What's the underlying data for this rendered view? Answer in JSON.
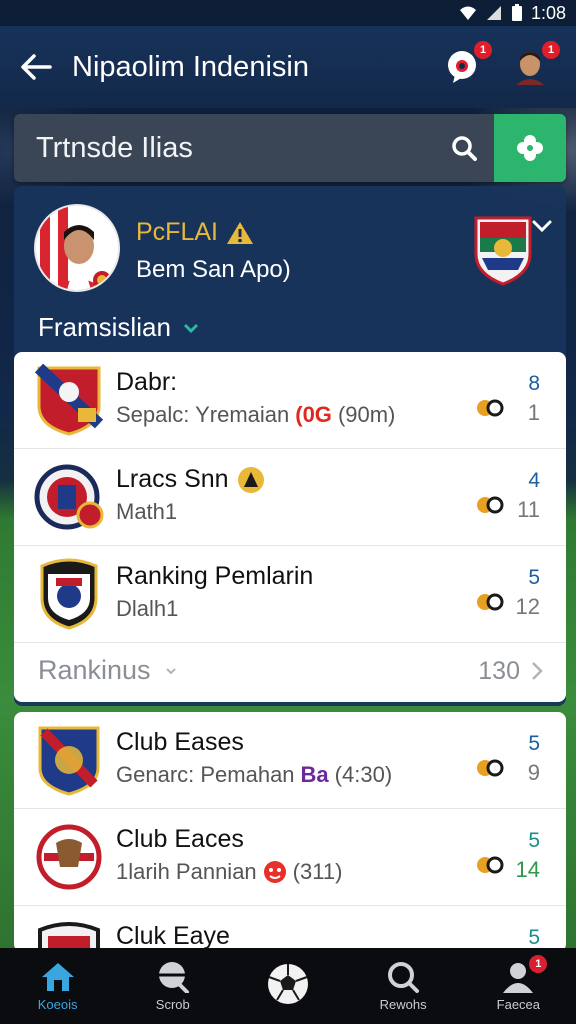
{
  "status_bar": {
    "time": "1:08"
  },
  "app_bar": {
    "title": "Nipaolim Indenisin",
    "chat_badge": "1",
    "profile_badge": "1"
  },
  "search": {
    "placeholder": "Trtnsde Ilias"
  },
  "player_panel": {
    "name": "PcFLAI",
    "subtitle": "Bem San Apo)",
    "section_title": "Framsislian"
  },
  "card1": {
    "rows": [
      {
        "name": "Dabr:",
        "sub_prefix": "Sepalc: Yremaian",
        "tag": "(0G",
        "sub_suffix": "(90m)",
        "num_top": "8",
        "num_bot": "1"
      },
      {
        "name": "Lracs Snn",
        "sub_prefix": "Math1",
        "tag": "",
        "sub_suffix": "",
        "num_top": "4",
        "num_bot": "11"
      },
      {
        "name": "Ranking Pemlarin",
        "sub_prefix": "Dlalh1",
        "tag": "",
        "sub_suffix": "",
        "num_top": "5",
        "num_bot": "12"
      }
    ],
    "footer": {
      "label": "Rankinus",
      "count": "130"
    }
  },
  "card2": {
    "rows": [
      {
        "name": "Club Eases",
        "sub_prefix": "Genarc: Pemahan",
        "tag": "Ba",
        "sub_suffix": "(4:30)",
        "num_top": "5",
        "num_bot": "9"
      },
      {
        "name": "Club Eaces",
        "sub_prefix": "1larih Pannian",
        "tag": "",
        "sub_suffix": "(311)",
        "num_top": "5",
        "num_bot": "14"
      },
      {
        "name": "Cluk Eaye",
        "sub_prefix": "",
        "tag": "",
        "sub_suffix": "",
        "num_top": "5",
        "num_bot": ""
      }
    ]
  },
  "bottom_nav": {
    "items": [
      {
        "label": "Koeois",
        "icon": "home-icon"
      },
      {
        "label": "Scrob",
        "icon": "search-globe-icon"
      },
      {
        "label": "",
        "icon": "soccer-ball-icon"
      },
      {
        "label": "Rewohs",
        "icon": "search-icon"
      },
      {
        "label": "Faecea",
        "icon": "profile-icon"
      }
    ],
    "profile_badge": "1"
  },
  "colors": {
    "accent_green": "#2cb56c",
    "app_bar": "#17325a",
    "nav_active": "#3aa6e0",
    "badge": "#e01e2a"
  }
}
